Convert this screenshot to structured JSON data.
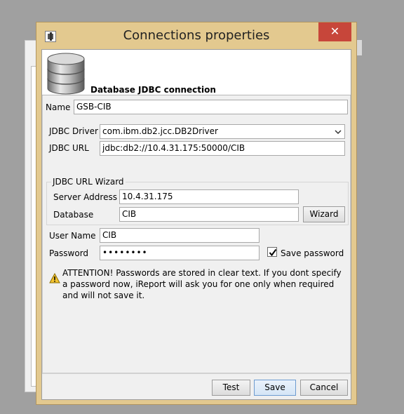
{
  "window": {
    "title": "Connections properties",
    "close_label": "✕"
  },
  "header": {
    "title": "Database JDBC connection"
  },
  "form": {
    "name_label": "Name",
    "name_value": "GSB-CIB",
    "jdbc_driver_label": "JDBC Driver",
    "jdbc_driver_value": "com.ibm.db2.jcc.DB2Driver",
    "jdbc_url_label": "JDBC URL",
    "jdbc_url_value": "jdbc:db2://10.4.31.175:50000/CIB",
    "wizard_group_label": "JDBC URL Wizard",
    "server_address_label": "Server Address",
    "server_address_value": "10.4.31.175",
    "database_label": "Database",
    "database_value": "CIB",
    "wizard_button_label": "Wizard",
    "username_label": "User Name",
    "username_value": "CIB",
    "password_label": "Password",
    "password_value": "••••••••",
    "save_password_label": "Save password",
    "save_password_checked": true
  },
  "warning": {
    "text": "ATTENTION! Passwords are stored in clear text. If you dont specify a password now, iReport will ask you for one only when required and will not save it."
  },
  "buttons": {
    "test": "Test",
    "save": "Save",
    "cancel": "Cancel"
  },
  "colors": {
    "frame": "#e3c98f",
    "close": "#c7463a",
    "dialog_bg": "#f0f0f0"
  }
}
